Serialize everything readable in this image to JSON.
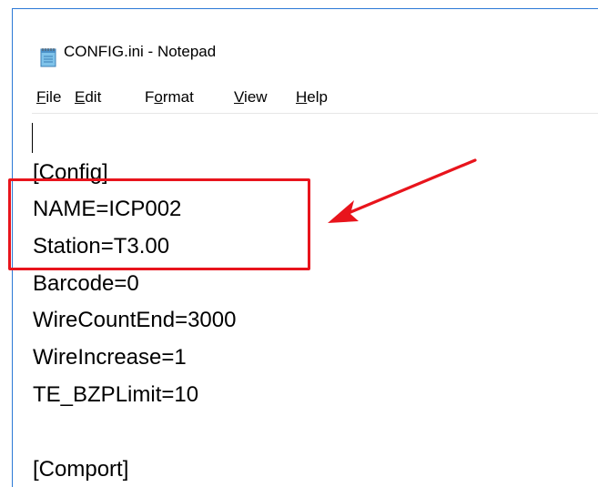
{
  "window": {
    "title": "CONFIG.ini - Notepad",
    "app_icon": "notepad-icon"
  },
  "menu": {
    "items": [
      {
        "prefix": "",
        "accel": "F",
        "rest": "ile"
      },
      {
        "prefix": "",
        "accel": "E",
        "rest": "dit"
      },
      {
        "prefix": "F",
        "accel": "o",
        "rest": "rmat"
      },
      {
        "prefix": "",
        "accel": "V",
        "rest": "iew"
      },
      {
        "prefix": "",
        "accel": "H",
        "rest": "elp"
      }
    ]
  },
  "editor": {
    "lines": [
      "[Config]",
      "NAME=ICP002",
      "Station=T3.00",
      "Barcode=0",
      "WireCountEnd=3000",
      "WireIncrease=1",
      "TE_BZPLimit=10",
      "",
      "[Comport]"
    ]
  },
  "annotation": {
    "highlight_color": "#e8141c",
    "arrow_color": "#e8141c",
    "highlighted_lines": [
      "NAME=ICP002",
      "Station=T3.00"
    ]
  }
}
